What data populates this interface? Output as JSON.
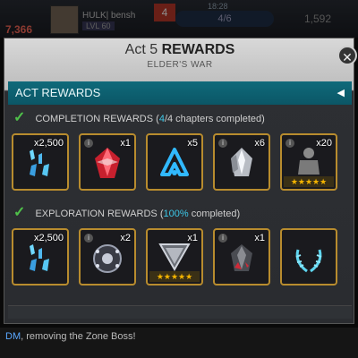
{
  "hud": {
    "gold": "7,366",
    "name": "HULK| bensh",
    "level": "LVL 60",
    "alert_count": "4",
    "clock": "18:28",
    "energy": "4/6",
    "units": "1,592"
  },
  "panel": {
    "title_act": "Act 5",
    "title_rewards": "REWARDS",
    "subtitle": "ELDER'S WAR",
    "act_rewards_label": "ACT REWARDS",
    "completion": {
      "label": "COMPLETION REWARDS",
      "progress_open": "(",
      "progress_value": "4",
      "progress_rest": "/4 chapters completed)",
      "items": [
        {
          "name": "shards",
          "qty": "x2,500"
        },
        {
          "name": "red-crystal",
          "qty": "x1"
        },
        {
          "name": "blue-tether",
          "qty": "x5"
        },
        {
          "name": "white-crystal",
          "qty": "x6"
        },
        {
          "name": "champion",
          "qty": "x20",
          "stars": "★★★★★"
        }
      ]
    },
    "exploration": {
      "label": "EXPLORATION REWARDS",
      "progress_open": "(",
      "progress_value": "100%",
      "progress_rest": " completed)",
      "items": [
        {
          "name": "shards",
          "qty": "x2,500"
        },
        {
          "name": "circuit-orb",
          "qty": "x2"
        },
        {
          "name": "shield-crystal",
          "qty": "x1",
          "stars": "★★★★★"
        },
        {
          "name": "dark-crystal",
          "qty": "x1"
        },
        {
          "name": "laurel",
          "qty": ""
        }
      ]
    }
  },
  "chat": {
    "highlight": "DM",
    "text": ", removing the Zone Boss!"
  },
  "colors": {
    "accent_cyan": "#3cc6e6",
    "act_bar": "#0f6a7a",
    "frame_gold": "#b88c2e",
    "check_green": "#4fc04a"
  }
}
